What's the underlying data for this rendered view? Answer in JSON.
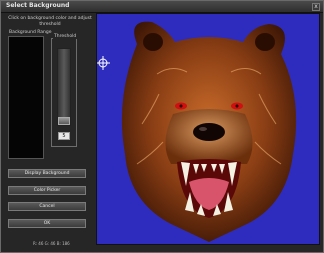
{
  "window": {
    "title": "Select Background",
    "close_label": "x"
  },
  "left_panel": {
    "instruction": "Click on background color and adjust threshold",
    "range_label": "Background Range",
    "threshold_label": "Threshold",
    "threshold_value": "5"
  },
  "buttons": {
    "display": "Display Background",
    "color_picker": "Color Picker",
    "cancel": "Cancel",
    "ok": "OK"
  },
  "readout": "R: 46 G: 46 B: 186",
  "colors": {
    "background_key": "#2e2cbf"
  },
  "icons": {
    "cursor": "crosshair-icon"
  }
}
